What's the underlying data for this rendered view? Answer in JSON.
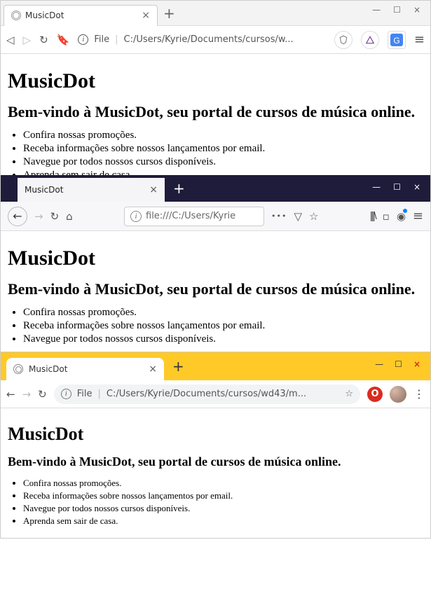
{
  "page_content": {
    "heading": "MusicDot",
    "subheading": "Bem-vindo à MusicDot, seu portal de cursos de música online.",
    "bullets": [
      "Confira nossas promoções.",
      "Receba informações sobre nossos lançamentos por email.",
      "Navegue por todos nossos cursos disponíveis.",
      "Aprenda sem sair de casa."
    ]
  },
  "browser1": {
    "tab_title": "MusicDot",
    "url_scheme": "File",
    "url_path": "C:/Users/Kyrie/Documents/cursos/w..."
  },
  "browser2": {
    "tab_title": "MusicDot",
    "url_path": "file:///C:/Users/Kyrie"
  },
  "browser3": {
    "tab_title": "MusicDot",
    "url_scheme": "File",
    "url_path": "C:/Users/Kyrie/Documents/cursos/wd43/m..."
  },
  "glyphs": {
    "close": "×",
    "plus": "+",
    "min": "—",
    "max": "☐",
    "back": "◁",
    "fwd": "▷",
    "reload": "↻",
    "bookmark": "🔖",
    "info": "i",
    "menu": "≡",
    "dots": "⋮",
    "ellipsis": "•••",
    "shield": "▽",
    "star": "☆",
    "home": "⌂",
    "left": "←",
    "right": "→",
    "lib": "|||\\",
    "sq": "▫"
  }
}
